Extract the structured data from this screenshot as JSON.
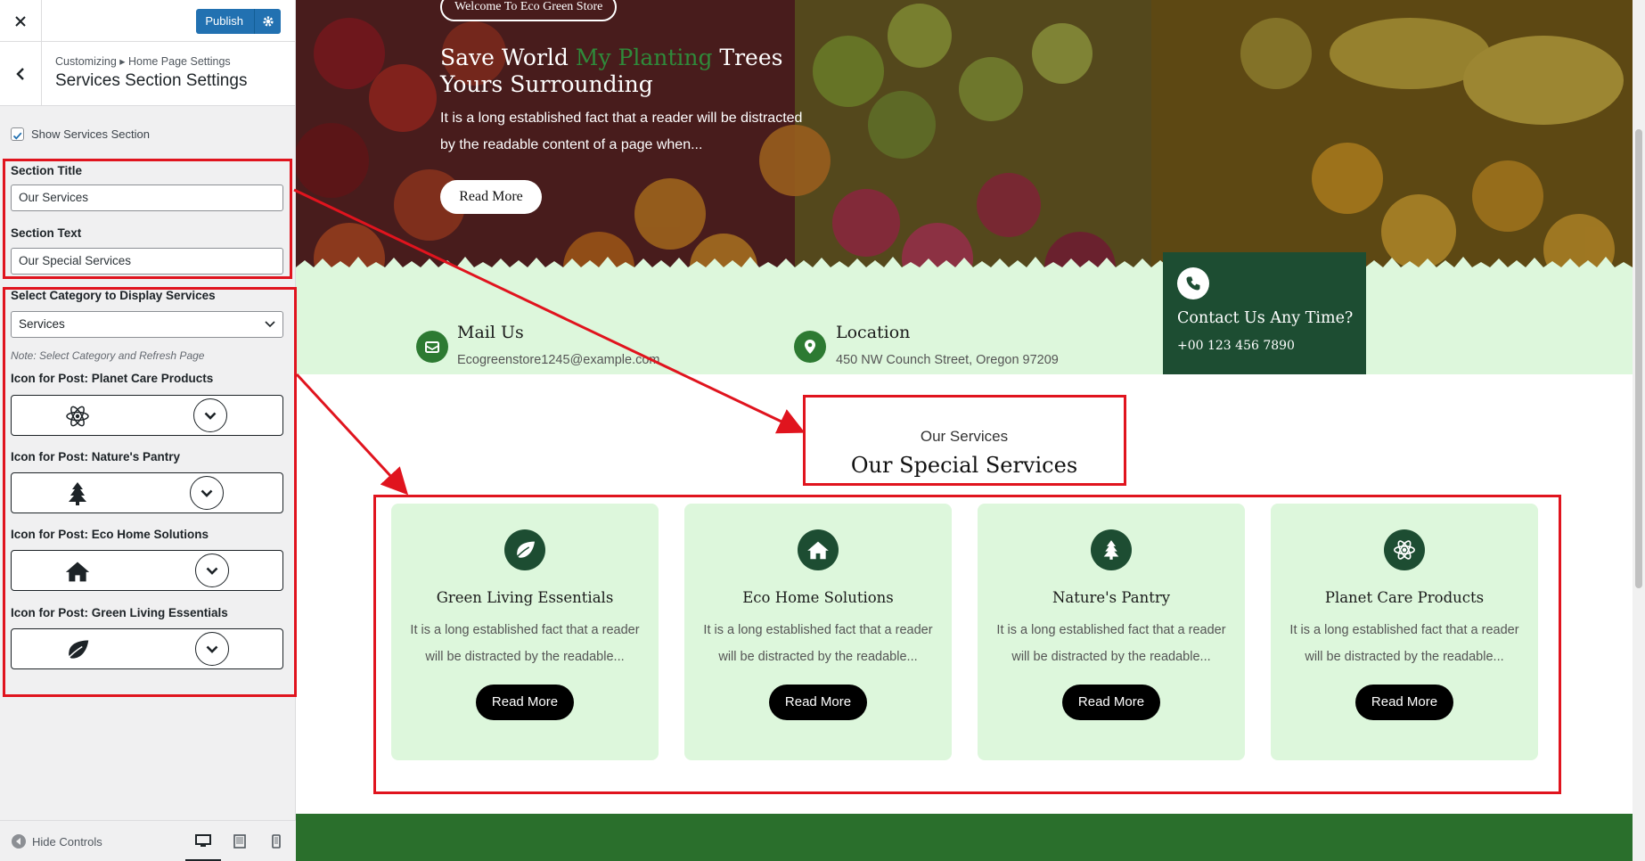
{
  "customizer": {
    "publish_label": "Publish",
    "breadcrumb": "Customizing ▸ Home Page Settings",
    "section_title": "Services Section Settings",
    "show_services_label": "Show Services Section",
    "show_services_checked": true,
    "section_title_label": "Section Title",
    "section_title_value": "Our Services",
    "section_text_label": "Section Text",
    "section_text_value": "Our Special Services",
    "category_label": "Select Category to Display Services",
    "category_selected": "Services",
    "note": "Note: Select Category and Refresh Page",
    "icon_pickers": [
      {
        "label": "Icon for Post: Planet Care Products",
        "icon": "atom-icon"
      },
      {
        "label": "Icon for Post: Nature's Pantry",
        "icon": "tree-icon"
      },
      {
        "label": "Icon for Post: Eco Home Solutions",
        "icon": "home-icon"
      },
      {
        "label": "Icon for Post: Green Living Essentials",
        "icon": "leaf-icon"
      }
    ],
    "hide_controls_label": "Hide Controls",
    "accent_color": "#2271b1"
  },
  "preview": {
    "hero": {
      "welcome": "Welcome To Eco Green Store",
      "title_part1": "Save World ",
      "title_green": "My Planting",
      "title_part2": " Trees Yours Surrounding",
      "description": "It is a long established fact that a reader will be distracted by the readable content of a page when...",
      "button": "Read More"
    },
    "info": {
      "mail_title": "Mail Us",
      "mail_value": "Ecogreenstore1245@example.com",
      "location_title": "Location",
      "location_value": "450 NW Counch Street, Oregon 97209",
      "contact_title": "Contact Us Any Time?",
      "contact_phone": "+00 123 456 7890"
    },
    "services": {
      "kicker": "Our Services",
      "heading": "Our Special Services",
      "cards": [
        {
          "title": "Green Living Essentials",
          "desc": "It is a long established fact that a reader will be distracted by the readable...",
          "button": "Read More",
          "icon": "leaf-icon"
        },
        {
          "title": "Eco Home Solutions",
          "desc": "It is a long established fact that a reader will be distracted by the readable...",
          "button": "Read More",
          "icon": "home-icon"
        },
        {
          "title": "Nature's Pantry",
          "desc": "It is a long established fact that a reader will be distracted by the readable...",
          "button": "Read More",
          "icon": "tree-icon"
        },
        {
          "title": "Planet Care Products",
          "desc": "It is a long established fact that a reader will be distracted by the readable...",
          "button": "Read More",
          "icon": "atom-icon"
        }
      ]
    },
    "colors": {
      "dark_green": "#1d4d32",
      "light_green": "#ddf7dc",
      "footer_green": "#2a6f2c",
      "annotation_red": "#e0141e"
    }
  }
}
